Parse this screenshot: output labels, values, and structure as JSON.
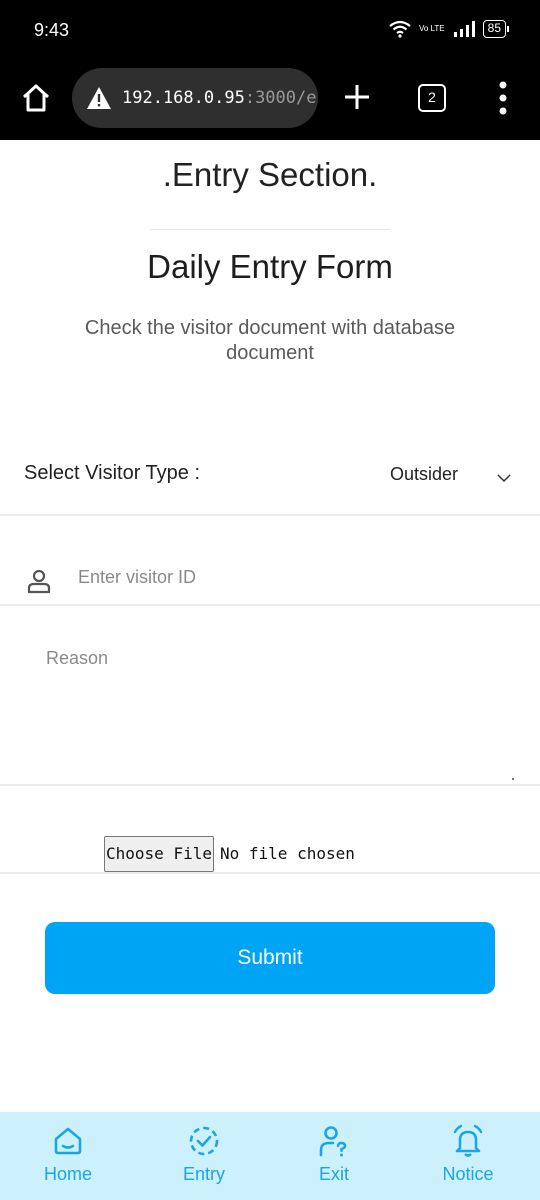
{
  "status_bar": {
    "time": "9:43",
    "volte": "Vo LTE",
    "battery": "85"
  },
  "browser": {
    "url_host": "192.168.0.95",
    "url_rest": ":3000/e",
    "tab_count": "2"
  },
  "page": {
    "section_title": ".Entry Section.",
    "form_title": "Daily Entry Form",
    "subtitle": "Check the visitor document with database document"
  },
  "form": {
    "visitor_type_label": "Select Visitor Type :",
    "visitor_type_value": "Outsider",
    "visitor_id_placeholder": "Enter visitor ID",
    "reason_placeholder": "Reason",
    "file_button_label": "Choose File",
    "file_status": "No file chosen",
    "submit_label": "Submit"
  },
  "bottom_nav": {
    "items": [
      {
        "label": "Home",
        "icon": "home-icon"
      },
      {
        "label": "Entry",
        "icon": "entry-check-icon"
      },
      {
        "label": "Exit",
        "icon": "user-question-icon"
      },
      {
        "label": "Notice",
        "icon": "alarm-bell-icon"
      }
    ]
  },
  "colors": {
    "accent": "#00a4f5",
    "nav_background": "#cdf0fd",
    "nav_icon": "#1aa6e6"
  }
}
